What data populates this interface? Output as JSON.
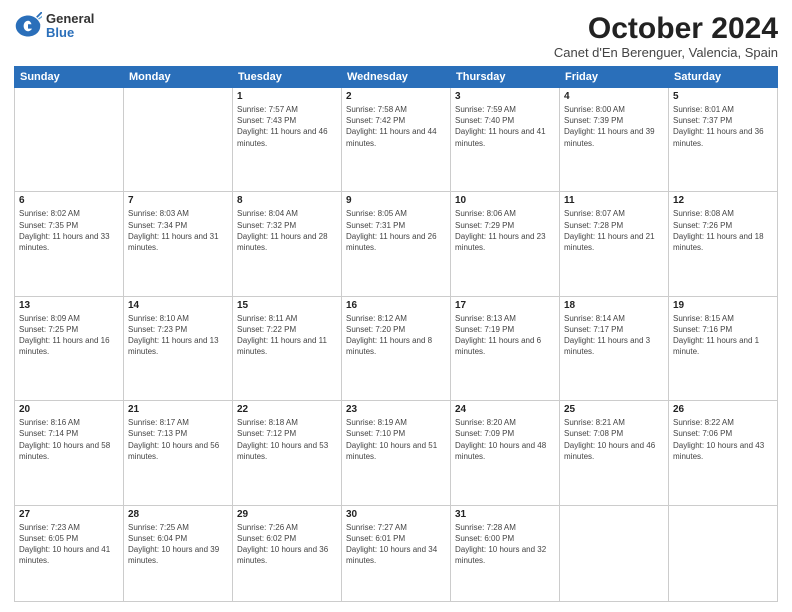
{
  "logo": {
    "general": "General",
    "blue": "Blue"
  },
  "header": {
    "month": "October 2024",
    "location": "Canet d'En Berenguer, Valencia, Spain"
  },
  "weekdays": [
    "Sunday",
    "Monday",
    "Tuesday",
    "Wednesday",
    "Thursday",
    "Friday",
    "Saturday"
  ],
  "weeks": [
    [
      {
        "day": "",
        "sunrise": "",
        "sunset": "",
        "daylight": ""
      },
      {
        "day": "",
        "sunrise": "",
        "sunset": "",
        "daylight": ""
      },
      {
        "day": "1",
        "sunrise": "Sunrise: 7:57 AM",
        "sunset": "Sunset: 7:43 PM",
        "daylight": "Daylight: 11 hours and 46 minutes."
      },
      {
        "day": "2",
        "sunrise": "Sunrise: 7:58 AM",
        "sunset": "Sunset: 7:42 PM",
        "daylight": "Daylight: 11 hours and 44 minutes."
      },
      {
        "day": "3",
        "sunrise": "Sunrise: 7:59 AM",
        "sunset": "Sunset: 7:40 PM",
        "daylight": "Daylight: 11 hours and 41 minutes."
      },
      {
        "day": "4",
        "sunrise": "Sunrise: 8:00 AM",
        "sunset": "Sunset: 7:39 PM",
        "daylight": "Daylight: 11 hours and 39 minutes."
      },
      {
        "day": "5",
        "sunrise": "Sunrise: 8:01 AM",
        "sunset": "Sunset: 7:37 PM",
        "daylight": "Daylight: 11 hours and 36 minutes."
      }
    ],
    [
      {
        "day": "6",
        "sunrise": "Sunrise: 8:02 AM",
        "sunset": "Sunset: 7:35 PM",
        "daylight": "Daylight: 11 hours and 33 minutes."
      },
      {
        "day": "7",
        "sunrise": "Sunrise: 8:03 AM",
        "sunset": "Sunset: 7:34 PM",
        "daylight": "Daylight: 11 hours and 31 minutes."
      },
      {
        "day": "8",
        "sunrise": "Sunrise: 8:04 AM",
        "sunset": "Sunset: 7:32 PM",
        "daylight": "Daylight: 11 hours and 28 minutes."
      },
      {
        "day": "9",
        "sunrise": "Sunrise: 8:05 AM",
        "sunset": "Sunset: 7:31 PM",
        "daylight": "Daylight: 11 hours and 26 minutes."
      },
      {
        "day": "10",
        "sunrise": "Sunrise: 8:06 AM",
        "sunset": "Sunset: 7:29 PM",
        "daylight": "Daylight: 11 hours and 23 minutes."
      },
      {
        "day": "11",
        "sunrise": "Sunrise: 8:07 AM",
        "sunset": "Sunset: 7:28 PM",
        "daylight": "Daylight: 11 hours and 21 minutes."
      },
      {
        "day": "12",
        "sunrise": "Sunrise: 8:08 AM",
        "sunset": "Sunset: 7:26 PM",
        "daylight": "Daylight: 11 hours and 18 minutes."
      }
    ],
    [
      {
        "day": "13",
        "sunrise": "Sunrise: 8:09 AM",
        "sunset": "Sunset: 7:25 PM",
        "daylight": "Daylight: 11 hours and 16 minutes."
      },
      {
        "day": "14",
        "sunrise": "Sunrise: 8:10 AM",
        "sunset": "Sunset: 7:23 PM",
        "daylight": "Daylight: 11 hours and 13 minutes."
      },
      {
        "day": "15",
        "sunrise": "Sunrise: 8:11 AM",
        "sunset": "Sunset: 7:22 PM",
        "daylight": "Daylight: 11 hours and 11 minutes."
      },
      {
        "day": "16",
        "sunrise": "Sunrise: 8:12 AM",
        "sunset": "Sunset: 7:20 PM",
        "daylight": "Daylight: 11 hours and 8 minutes."
      },
      {
        "day": "17",
        "sunrise": "Sunrise: 8:13 AM",
        "sunset": "Sunset: 7:19 PM",
        "daylight": "Daylight: 11 hours and 6 minutes."
      },
      {
        "day": "18",
        "sunrise": "Sunrise: 8:14 AM",
        "sunset": "Sunset: 7:17 PM",
        "daylight": "Daylight: 11 hours and 3 minutes."
      },
      {
        "day": "19",
        "sunrise": "Sunrise: 8:15 AM",
        "sunset": "Sunset: 7:16 PM",
        "daylight": "Daylight: 11 hours and 1 minute."
      }
    ],
    [
      {
        "day": "20",
        "sunrise": "Sunrise: 8:16 AM",
        "sunset": "Sunset: 7:14 PM",
        "daylight": "Daylight: 10 hours and 58 minutes."
      },
      {
        "day": "21",
        "sunrise": "Sunrise: 8:17 AM",
        "sunset": "Sunset: 7:13 PM",
        "daylight": "Daylight: 10 hours and 56 minutes."
      },
      {
        "day": "22",
        "sunrise": "Sunrise: 8:18 AM",
        "sunset": "Sunset: 7:12 PM",
        "daylight": "Daylight: 10 hours and 53 minutes."
      },
      {
        "day": "23",
        "sunrise": "Sunrise: 8:19 AM",
        "sunset": "Sunset: 7:10 PM",
        "daylight": "Daylight: 10 hours and 51 minutes."
      },
      {
        "day": "24",
        "sunrise": "Sunrise: 8:20 AM",
        "sunset": "Sunset: 7:09 PM",
        "daylight": "Daylight: 10 hours and 48 minutes."
      },
      {
        "day": "25",
        "sunrise": "Sunrise: 8:21 AM",
        "sunset": "Sunset: 7:08 PM",
        "daylight": "Daylight: 10 hours and 46 minutes."
      },
      {
        "day": "26",
        "sunrise": "Sunrise: 8:22 AM",
        "sunset": "Sunset: 7:06 PM",
        "daylight": "Daylight: 10 hours and 43 minutes."
      }
    ],
    [
      {
        "day": "27",
        "sunrise": "Sunrise: 7:23 AM",
        "sunset": "Sunset: 6:05 PM",
        "daylight": "Daylight: 10 hours and 41 minutes."
      },
      {
        "day": "28",
        "sunrise": "Sunrise: 7:25 AM",
        "sunset": "Sunset: 6:04 PM",
        "daylight": "Daylight: 10 hours and 39 minutes."
      },
      {
        "day": "29",
        "sunrise": "Sunrise: 7:26 AM",
        "sunset": "Sunset: 6:02 PM",
        "daylight": "Daylight: 10 hours and 36 minutes."
      },
      {
        "day": "30",
        "sunrise": "Sunrise: 7:27 AM",
        "sunset": "Sunset: 6:01 PM",
        "daylight": "Daylight: 10 hours and 34 minutes."
      },
      {
        "day": "31",
        "sunrise": "Sunrise: 7:28 AM",
        "sunset": "Sunset: 6:00 PM",
        "daylight": "Daylight: 10 hours and 32 minutes."
      },
      {
        "day": "",
        "sunrise": "",
        "sunset": "",
        "daylight": ""
      },
      {
        "day": "",
        "sunrise": "",
        "sunset": "",
        "daylight": ""
      }
    ]
  ]
}
